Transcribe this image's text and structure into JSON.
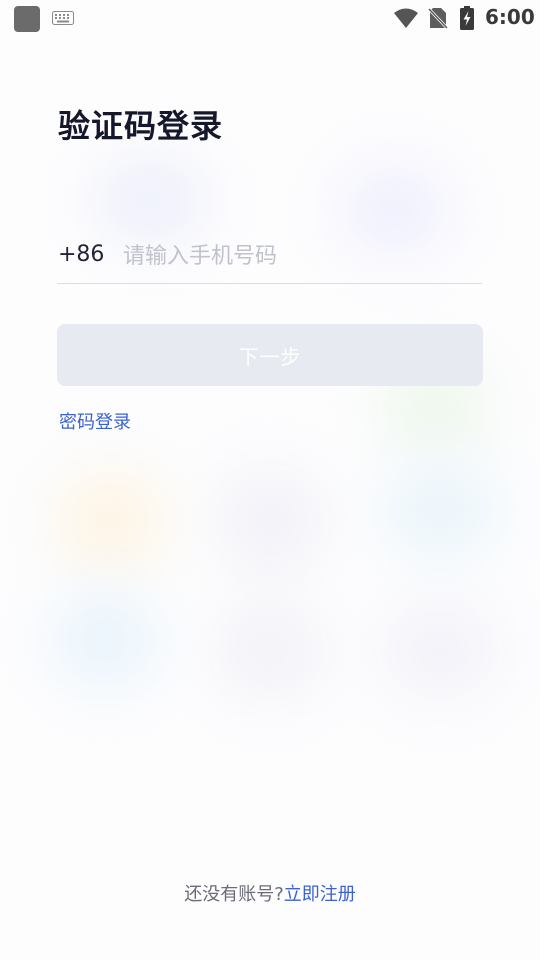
{
  "status_bar": {
    "time": "6:00",
    "icons": [
      "app-icon",
      "keyboard-icon",
      "wifi-icon",
      "no-sim-icon",
      "battery-charging-icon"
    ]
  },
  "page": {
    "title": "验证码登录"
  },
  "phone": {
    "country_code": "+86",
    "value": "",
    "placeholder": "请输入手机号码"
  },
  "next_button": {
    "label": "下一步"
  },
  "password_login": {
    "label": "密码登录"
  },
  "footer": {
    "prompt": "还没有账号?",
    "register_label": "立即注册"
  },
  "colors": {
    "title": "#15172b",
    "accent_link": "#3b62cf",
    "button_disabled_bg": "#e8eaf1",
    "button_text": "#ffffff",
    "placeholder": "#c0c2cc",
    "divider": "#dcdde4"
  }
}
